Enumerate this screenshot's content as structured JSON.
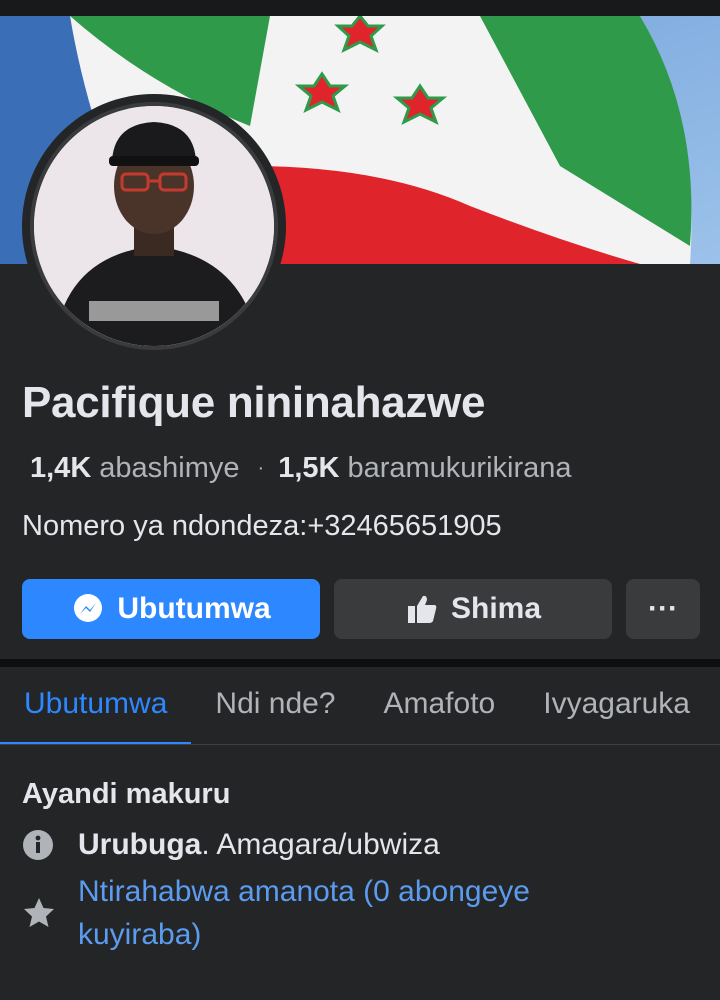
{
  "profile": {
    "name": "Pacifique nininahazwe",
    "likes_count": "1,4K",
    "likes_label": "abashimye",
    "followers_count": "1,5K",
    "followers_label": "baramukurikirana",
    "contact_line": "Nomero ya ndondeza:+32465651905"
  },
  "actions": {
    "message_label": "Ubutumwa",
    "like_label": "Shima",
    "more_label": "···"
  },
  "tabs": [
    {
      "label": "Ubutumwa",
      "active": true
    },
    {
      "label": "Ndi nde?",
      "active": false
    },
    {
      "label": "Amafoto",
      "active": false
    },
    {
      "label": "Ivyagaruka",
      "active": false
    }
  ],
  "about": {
    "title": "Ayandi makuru",
    "page_type_label": "Urubuga",
    "page_category": " . Amagara/ubwiza",
    "rating_text": "Ntirahabwa amanota (0 abongeye kuyiraba)"
  },
  "colors": {
    "background": "#242526",
    "accent": "#2d88ff",
    "button_secondary": "#3a3b3c",
    "link": "#5b9cf0"
  },
  "icons": {
    "message": "messenger-icon",
    "like": "thumbs-up-icon",
    "info": "info-icon",
    "rating": "star-icon"
  }
}
